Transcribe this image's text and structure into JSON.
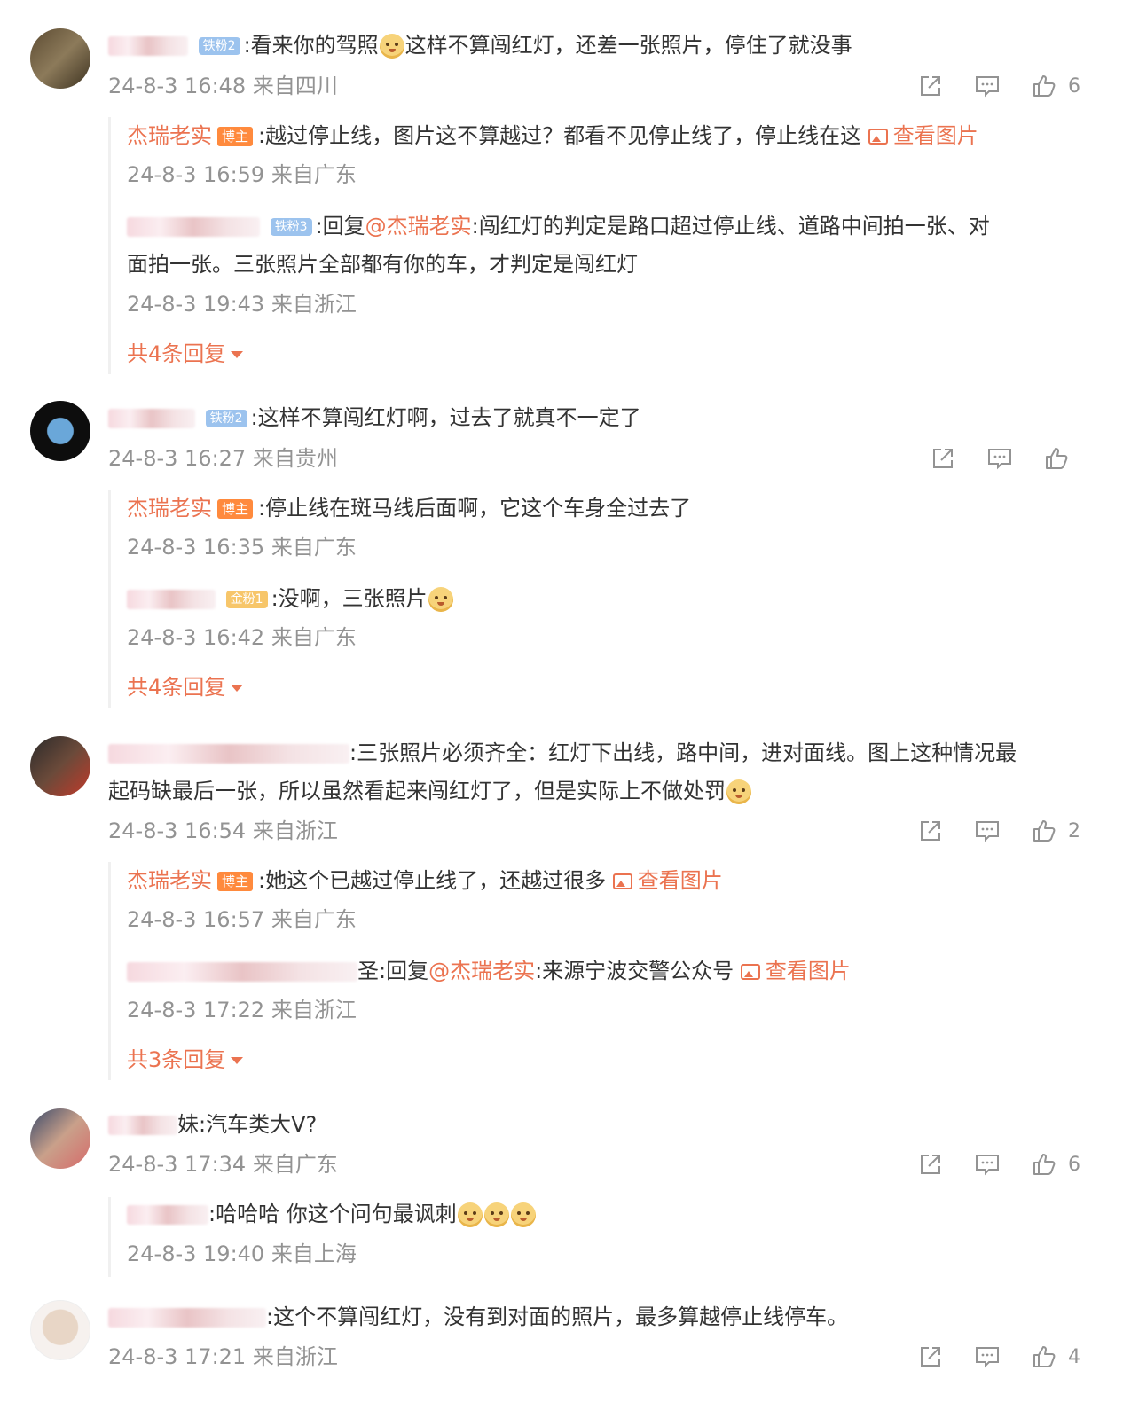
{
  "comments": [
    {
      "text_pre": ":看来你的驾照",
      "text_post": "这样不算闯红灯，还差一张照片，停住了就没事",
      "fan_badge": "铁粉2",
      "meta": "24-8-3 16:48 来自四川",
      "likes": "6",
      "replies": [
        {
          "author": "杰瑞老实",
          "badge": "博主",
          "text": ":越过停止线，图片这不算越过？都看不见停止线了，停止线在这",
          "link": "查看图片",
          "meta": "24-8-3 16:59 来自广东"
        },
        {
          "fan_badge": "铁粉3",
          "text_a": ":回复",
          "mention": "@杰瑞老实",
          "text_b": ":闯红灯的判定是路口超过停止线、道路中间拍一张、对",
          "text_c": "面拍一张。三张照片全部都有你的车，才判定是闯红灯",
          "meta": "24-8-3 19:43 来自浙江"
        }
      ],
      "more": "共4条回复"
    },
    {
      "fan_badge": "铁粉2",
      "text": ":这样不算闯红灯啊，过去了就真不一定了",
      "meta": "24-8-3 16:27 来自贵州",
      "likes": "",
      "replies": [
        {
          "author": "杰瑞老实",
          "badge": "博主",
          "text": ":停止线在斑马线后面啊，它这个车身全过去了",
          "meta": "24-8-3 16:35 来自广东"
        },
        {
          "fan_badge": "金粉1",
          "text": ":没啊，三张照片",
          "meta": "24-8-3 16:42 来自广东"
        }
      ],
      "more": "共4条回复"
    },
    {
      "text_a": ":三张照片必须齐全：红灯下出线，路中间，进对面线。图上这种情况最",
      "text_b": "起码缺最后一张，所以虽然看起来闯红灯了，但是实际上不做处罚",
      "meta": "24-8-3 16:54 来自浙江",
      "likes": "2",
      "replies": [
        {
          "author": "杰瑞老实",
          "badge": "博主",
          "text": ":她这个已越过停止线了，还越过很多",
          "link": "查看图片",
          "meta": "24-8-3 16:57 来自广东"
        },
        {
          "name_tail": "圣",
          "text_a": ":回复",
          "mention": "@杰瑞老实",
          "text_b": ":来源宁波交警公众号",
          "link": "查看图片",
          "meta": "24-8-3 17:22 来自浙江"
        }
      ],
      "more": "共3条回复"
    },
    {
      "name_tail": "妹",
      "text": ":汽车类大V?",
      "meta": "24-8-3 17:34 来自广东",
      "likes": "6",
      "replies": [
        {
          "text": ":哈哈哈 你这个问句最讽刺",
          "meta": "24-8-3 19:40 来自上海"
        }
      ]
    },
    {
      "text": ":这个不算闯红灯，没有到对面的照片，最多算越停止线停车。",
      "meta": "24-8-3 17:21 来自浙江",
      "likes": "4"
    }
  ],
  "icons": {
    "share": "share-icon",
    "comment": "comment-icon",
    "like": "like-icon",
    "image": "image-icon"
  },
  "colors": {
    "accent": "#eb7350",
    "meta": "#939393",
    "text": "#333333"
  }
}
